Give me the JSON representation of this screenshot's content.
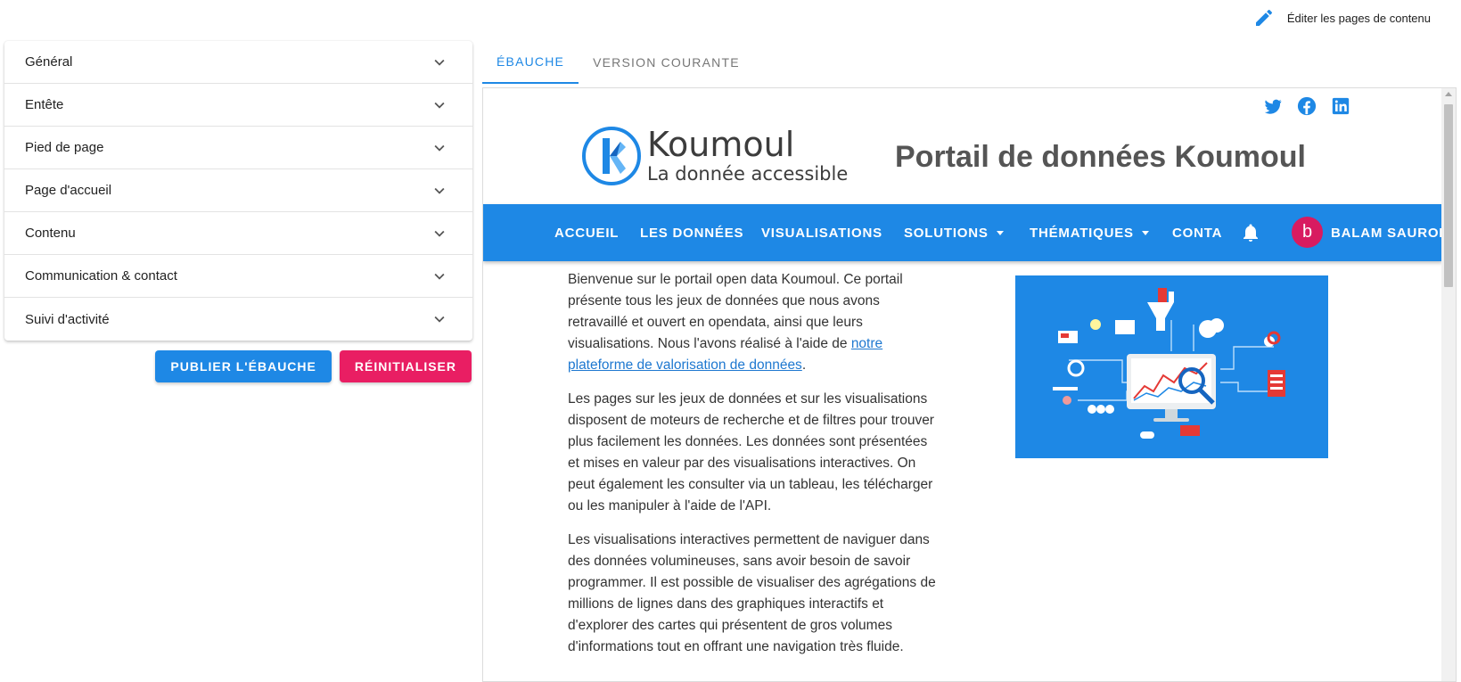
{
  "top": {
    "edit_label": "Éditer les pages de contenu",
    "edit_icon": "pencil-icon"
  },
  "accordion": {
    "items": [
      {
        "label": "Général"
      },
      {
        "label": "Entête"
      },
      {
        "label": "Pied de page"
      },
      {
        "label": "Page d'accueil"
      },
      {
        "label": "Contenu"
      },
      {
        "label": "Communication & contact"
      },
      {
        "label": "Suivi d'activité"
      }
    ]
  },
  "actions": {
    "publish_label": "PUBLIER L'ÉBAUCHE",
    "reset_label": "RÉINITIALISER"
  },
  "tabs": [
    {
      "label": "ÉBAUCHE",
      "active": true
    },
    {
      "label": "VERSION COURANTE",
      "active": false
    }
  ],
  "preview": {
    "social_icons": [
      "twitter-icon",
      "facebook-icon",
      "linkedin-icon"
    ],
    "brand": {
      "name": "Koumoul",
      "tagline": "La donnée accessible"
    },
    "site_title": "Portail de données Koumoul",
    "nav": {
      "items": [
        {
          "label": "ACCUEIL"
        },
        {
          "label": "LES DONNÉES"
        },
        {
          "label": "VISUALISATIONS"
        },
        {
          "label": "SOLUTIONS"
        },
        {
          "label": "THÉMATIQUES"
        },
        {
          "label": "CONTACT"
        }
      ],
      "avatar_letter": "b",
      "user_name": "BALAM SAURON"
    },
    "paragraphs": {
      "p1_text": "Bienvenue sur le portail open data Koumoul. Ce portail présente tous les jeux de données que nous avons retravaillé et ouvert en opendata, ainsi que leurs visualisations. Nous l'avons réalisé à l'aide de ",
      "p1_link": "notre plateforme de valorisation de données",
      "p1_end": ".",
      "p2": "Les pages sur les jeux de données et sur les visualisations disposent de moteurs de recherche et de filtres pour trouver plus facilement les données. Les données sont présentées et mises en valeur par des visualisations interactives. On peut également les consulter via un tableau, les télécharger ou les manipuler à l'aide de l'API.",
      "p3": "Les visualisations interactives permettent de naviguer dans des données volumineuses, sans avoir besoin de savoir programmer. Il est possible de visualiser des agrégations de millions de lignes dans des graphiques interactifs et d'explorer des cartes qui présentent de gros volumes d'informations tout en offrant une navigation très fluide."
    },
    "colors": {
      "primary": "#1e88e5",
      "accent": "#e91e63"
    }
  }
}
